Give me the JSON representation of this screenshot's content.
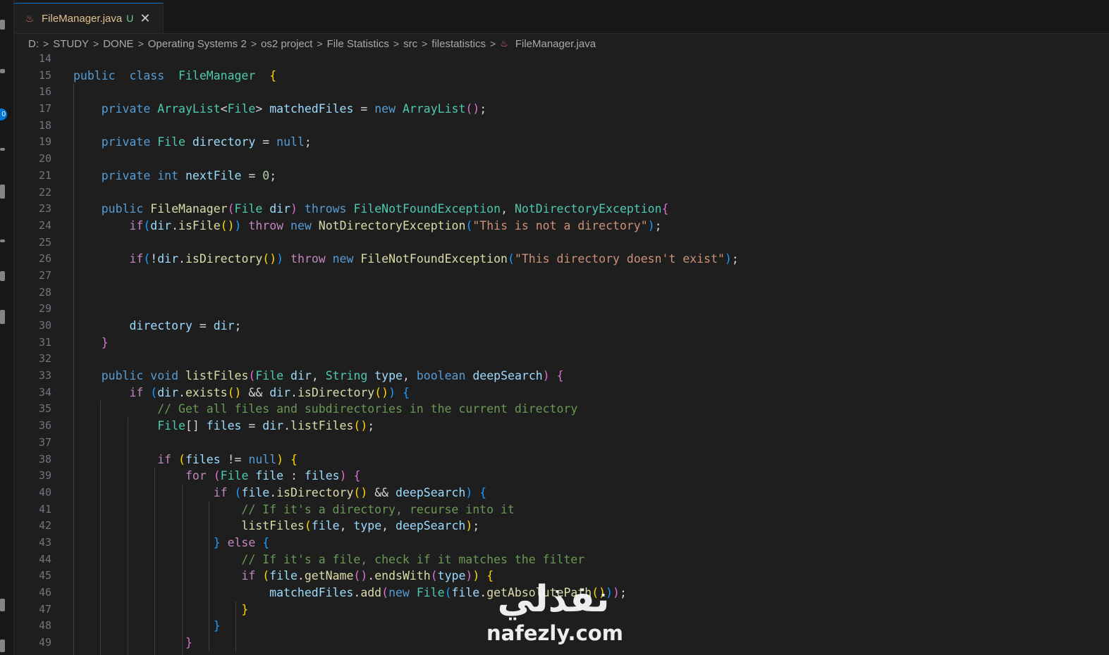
{
  "tab": {
    "icon": "java-file-icon",
    "filename": "FileManager.java",
    "status": "U",
    "close": "✕"
  },
  "activity": {
    "badge": "0"
  },
  "breadcrumb": [
    "D:",
    "STUDY",
    "DONE",
    "Operating Systems 2",
    "os2 project",
    "File Statistics",
    "src",
    "filestatistics",
    "FileManager.java"
  ],
  "line_numbers": [
    "14",
    "15",
    "16",
    "17",
    "18",
    "19",
    "20",
    "21",
    "22",
    "23",
    "24",
    "25",
    "26",
    "27",
    "28",
    "29",
    "30",
    "31",
    "32",
    "33",
    "34",
    "35",
    "36",
    "37",
    "38",
    "39",
    "40",
    "41",
    "42",
    "43",
    "44",
    "45",
    "46",
    "47",
    "48",
    "49"
  ],
  "code": [
    [],
    [
      [
        "kw",
        "public"
      ],
      [
        "",
        "  "
      ],
      [
        "kw",
        "class"
      ],
      [
        "",
        "  "
      ],
      [
        "typ",
        "FileManager"
      ],
      [
        "",
        "  "
      ],
      [
        "b1",
        "{"
      ]
    ],
    [],
    [
      [
        "",
        "    "
      ],
      [
        "kw",
        "private"
      ],
      [
        "",
        " "
      ],
      [
        "typ",
        "ArrayList"
      ],
      [
        "",
        "<"
      ],
      [
        "typ",
        "File"
      ],
      [
        "",
        "> "
      ],
      [
        "var",
        "matchedFiles"
      ],
      [
        "",
        " = "
      ],
      [
        "kw",
        "new"
      ],
      [
        "",
        " "
      ],
      [
        "typ",
        "ArrayList"
      ],
      [
        "b2",
        "()"
      ],
      [
        "",
        ";"
      ]
    ],
    [],
    [
      [
        "",
        "    "
      ],
      [
        "kw",
        "private"
      ],
      [
        "",
        " "
      ],
      [
        "typ",
        "File"
      ],
      [
        "",
        " "
      ],
      [
        "var",
        "directory"
      ],
      [
        "",
        " = "
      ],
      [
        "kw",
        "null"
      ],
      [
        "",
        ";"
      ]
    ],
    [],
    [
      [
        "",
        "    "
      ],
      [
        "kw",
        "private"
      ],
      [
        "",
        " "
      ],
      [
        "kw",
        "int"
      ],
      [
        "",
        " "
      ],
      [
        "var",
        "nextFile"
      ],
      [
        "",
        " = "
      ],
      [
        "num",
        "0"
      ],
      [
        "",
        ";"
      ]
    ],
    [],
    [
      [
        "",
        "    "
      ],
      [
        "kw",
        "public"
      ],
      [
        "",
        " "
      ],
      [
        "fn",
        "FileManager"
      ],
      [
        "b2",
        "("
      ],
      [
        "typ",
        "File"
      ],
      [
        "",
        " "
      ],
      [
        "var",
        "dir"
      ],
      [
        "b2",
        ")"
      ],
      [
        "",
        " "
      ],
      [
        "kw",
        "throws"
      ],
      [
        "",
        " "
      ],
      [
        "typ",
        "FileNotFoundException"
      ],
      [
        "",
        ", "
      ],
      [
        "typ",
        "NotDirectoryException"
      ],
      [
        "b2",
        "{"
      ]
    ],
    [
      [
        "",
        "        "
      ],
      [
        "ctl",
        "if"
      ],
      [
        "b3",
        "("
      ],
      [
        "var",
        "dir"
      ],
      [
        "",
        "."
      ],
      [
        "fn",
        "isFile"
      ],
      [
        "b1",
        "()"
      ],
      [
        "b3",
        ")"
      ],
      [
        "",
        " "
      ],
      [
        "ctl",
        "throw"
      ],
      [
        "",
        " "
      ],
      [
        "kw",
        "new"
      ],
      [
        "",
        " "
      ],
      [
        "fn",
        "NotDirectoryException"
      ],
      [
        "b3",
        "("
      ],
      [
        "str",
        "\"This is not a directory\""
      ],
      [
        "b3",
        ")"
      ],
      [
        "",
        ";"
      ]
    ],
    [],
    [
      [
        "",
        "        "
      ],
      [
        "ctl",
        "if"
      ],
      [
        "b3",
        "("
      ],
      [
        "",
        "!"
      ],
      [
        "var",
        "dir"
      ],
      [
        "",
        "."
      ],
      [
        "fn",
        "isDirectory"
      ],
      [
        "b1",
        "()"
      ],
      [
        "b3",
        ")"
      ],
      [
        "",
        " "
      ],
      [
        "ctl",
        "throw"
      ],
      [
        "",
        " "
      ],
      [
        "kw",
        "new"
      ],
      [
        "",
        " "
      ],
      [
        "fn",
        "FileNotFoundException"
      ],
      [
        "b3",
        "("
      ],
      [
        "str",
        "\"This directory doesn't exist\""
      ],
      [
        "b3",
        ")"
      ],
      [
        "",
        ";"
      ]
    ],
    [],
    [],
    [],
    [
      [
        "",
        "        "
      ],
      [
        "var",
        "directory"
      ],
      [
        "",
        " = "
      ],
      [
        "var",
        "dir"
      ],
      [
        "",
        ";"
      ]
    ],
    [
      [
        "",
        "    "
      ],
      [
        "b2",
        "}"
      ]
    ],
    [],
    [
      [
        "",
        "    "
      ],
      [
        "kw",
        "public"
      ],
      [
        "",
        " "
      ],
      [
        "kw",
        "void"
      ],
      [
        "",
        " "
      ],
      [
        "fn",
        "listFiles"
      ],
      [
        "b2",
        "("
      ],
      [
        "typ",
        "File"
      ],
      [
        "",
        " "
      ],
      [
        "var",
        "dir"
      ],
      [
        "",
        ", "
      ],
      [
        "typ",
        "String"
      ],
      [
        "",
        " "
      ],
      [
        "var",
        "type"
      ],
      [
        "",
        ", "
      ],
      [
        "kw",
        "boolean"
      ],
      [
        "",
        " "
      ],
      [
        "var",
        "deepSearch"
      ],
      [
        "b2",
        ")"
      ],
      [
        "",
        " "
      ],
      [
        "b2",
        "{"
      ]
    ],
    [
      [
        "",
        "        "
      ],
      [
        "ctl",
        "if"
      ],
      [
        "",
        " "
      ],
      [
        "b3",
        "("
      ],
      [
        "var",
        "dir"
      ],
      [
        "",
        "."
      ],
      [
        "fn",
        "exists"
      ],
      [
        "b1",
        "()"
      ],
      [
        "",
        " && "
      ],
      [
        "var",
        "dir"
      ],
      [
        "",
        "."
      ],
      [
        "fn",
        "isDirectory"
      ],
      [
        "b1",
        "()"
      ],
      [
        "b3",
        ")"
      ],
      [
        "",
        " "
      ],
      [
        "b3",
        "{"
      ]
    ],
    [
      [
        "",
        "            "
      ],
      [
        "cmt",
        "// Get all files and subdirectories in the current directory"
      ]
    ],
    [
      [
        "",
        "            "
      ],
      [
        "typ",
        "File"
      ],
      [
        "",
        "[] "
      ],
      [
        "var",
        "files"
      ],
      [
        "",
        " = "
      ],
      [
        "var",
        "dir"
      ],
      [
        "",
        "."
      ],
      [
        "fn",
        "listFiles"
      ],
      [
        "b1",
        "()"
      ],
      [
        "",
        ";"
      ]
    ],
    [],
    [
      [
        "",
        "            "
      ],
      [
        "ctl",
        "if"
      ],
      [
        "",
        " "
      ],
      [
        "b1",
        "("
      ],
      [
        "var",
        "files"
      ],
      [
        "",
        " != "
      ],
      [
        "kw",
        "null"
      ],
      [
        "b1",
        ")"
      ],
      [
        "",
        " "
      ],
      [
        "b1",
        "{"
      ]
    ],
    [
      [
        "",
        "                "
      ],
      [
        "ctl",
        "for"
      ],
      [
        "",
        " "
      ],
      [
        "b2",
        "("
      ],
      [
        "typ",
        "File"
      ],
      [
        "",
        " "
      ],
      [
        "var",
        "file"
      ],
      [
        "",
        " : "
      ],
      [
        "var",
        "files"
      ],
      [
        "b2",
        ")"
      ],
      [
        "",
        " "
      ],
      [
        "b2",
        "{"
      ]
    ],
    [
      [
        "",
        "                    "
      ],
      [
        "ctl",
        "if"
      ],
      [
        "",
        " "
      ],
      [
        "b3",
        "("
      ],
      [
        "var",
        "file"
      ],
      [
        "",
        "."
      ],
      [
        "fn",
        "isDirectory"
      ],
      [
        "b1",
        "()"
      ],
      [
        "",
        " && "
      ],
      [
        "var",
        "deepSearch"
      ],
      [
        "b3",
        ")"
      ],
      [
        "",
        " "
      ],
      [
        "b3",
        "{"
      ]
    ],
    [
      [
        "",
        "                        "
      ],
      [
        "cmt",
        "// If it's a directory, recurse into it"
      ]
    ],
    [
      [
        "",
        "                        "
      ],
      [
        "fn",
        "listFiles"
      ],
      [
        "b1",
        "("
      ],
      [
        "var",
        "file"
      ],
      [
        "",
        ", "
      ],
      [
        "var",
        "type"
      ],
      [
        "",
        ", "
      ],
      [
        "var",
        "deepSearch"
      ],
      [
        "b1",
        ")"
      ],
      [
        "",
        ";"
      ]
    ],
    [
      [
        "",
        "                    "
      ],
      [
        "b3",
        "}"
      ],
      [
        "",
        " "
      ],
      [
        "ctl",
        "else"
      ],
      [
        "",
        " "
      ],
      [
        "b3",
        "{"
      ]
    ],
    [
      [
        "",
        "                        "
      ],
      [
        "cmt",
        "// If it's a file, check if it matches the filter"
      ]
    ],
    [
      [
        "",
        "                        "
      ],
      [
        "ctl",
        "if"
      ],
      [
        "",
        " "
      ],
      [
        "b1",
        "("
      ],
      [
        "var",
        "file"
      ],
      [
        "",
        "."
      ],
      [
        "fn",
        "getName"
      ],
      [
        "b2",
        "()"
      ],
      [
        "",
        "."
      ],
      [
        "fn",
        "endsWith"
      ],
      [
        "b2",
        "("
      ],
      [
        "var",
        "type"
      ],
      [
        "b2",
        ")"
      ],
      [
        "b1",
        ")"
      ],
      [
        "",
        " "
      ],
      [
        "b1",
        "{"
      ]
    ],
    [
      [
        "",
        "                            "
      ],
      [
        "var",
        "matchedFiles"
      ],
      [
        "",
        "."
      ],
      [
        "fn",
        "add"
      ],
      [
        "b2",
        "("
      ],
      [
        "kw",
        "new"
      ],
      [
        "",
        " "
      ],
      [
        "typ",
        "File"
      ],
      [
        "b3",
        "("
      ],
      [
        "var",
        "file"
      ],
      [
        "",
        "."
      ],
      [
        "fn",
        "getAbsolutePath"
      ],
      [
        "b1",
        "()"
      ],
      [
        "b3",
        ")"
      ],
      [
        "b2",
        ")"
      ],
      [
        "",
        ";"
      ]
    ],
    [
      [
        "",
        "                        "
      ],
      [
        "b1",
        "}"
      ]
    ],
    [
      [
        "",
        "                    "
      ],
      [
        "b3",
        "}"
      ]
    ],
    [
      [
        "",
        "                "
      ],
      [
        "b2",
        "}"
      ]
    ]
  ],
  "watermark": {
    "arabic": "نفذلي",
    "latin": "nafezly.com"
  }
}
